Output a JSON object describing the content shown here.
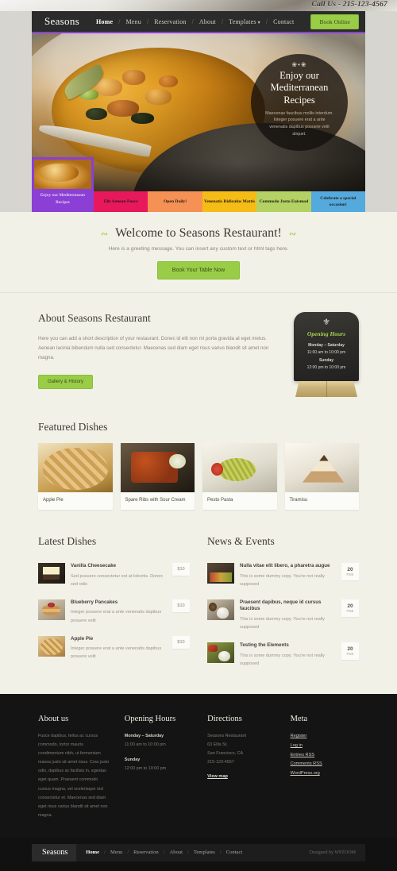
{
  "topbar": {
    "phone": "Call Us - 215-123-4567"
  },
  "header": {
    "logo": "Seasons",
    "nav": [
      {
        "label": "Home",
        "active": true
      },
      {
        "label": "Menu",
        "active": false
      },
      {
        "label": "Reservation",
        "active": false
      },
      {
        "label": "About",
        "active": false
      },
      {
        "label": "Templates",
        "active": false,
        "caret": "▾"
      },
      {
        "label": "Contact",
        "active": false
      }
    ],
    "book_online": "Book Online"
  },
  "hero": {
    "badge": {
      "ornament": "❀•❀",
      "title": "Enjoy our Mediterranean Recipes",
      "text": "Maecenas faucibus mollis interdum. Integer posuere erat a ante venenatis dapibus posuere velit aliquet."
    },
    "thumbs": [
      {
        "caption": "Enjoy our Mediterranean Recipes",
        "color": "#8b3fd4",
        "active": true
      },
      {
        "caption": "Elit Aenean Fusce",
        "color": "#e8185c",
        "active": false
      },
      {
        "caption": "Open Daily!",
        "color": "#f59154",
        "active": false
      },
      {
        "caption": "Venenatis Ridiculus Mattis",
        "color": "#f5bc17",
        "active": false
      },
      {
        "caption": "Commodo Justo Euismod",
        "color": "#b4d163",
        "active": false
      },
      {
        "caption": "Celebrate a special occasion!",
        "color": "#55aadd",
        "active": false
      }
    ]
  },
  "welcome": {
    "heading": "Welcome to Seasons Restaurant!",
    "subtext": "Here is a greeting message. You can insert any custom text or html tags here.",
    "cta": "Book Your Table Now"
  },
  "about": {
    "heading": "About Seasons Restaurant",
    "body": "Here you can add a short description of your restaurant. Donec id elit non mi porta gravida at eget metus. Aenean lacinia bibendum nulla sed consectetur. Maecenas sed diam eget risus varius blandit sit amet non magna.",
    "cta": "Gallery & History",
    "sign": {
      "fleur": "⚜",
      "title": "Opening Hours",
      "days1": "Monday – Saturday",
      "hours1": "11:00 am to 10:00 pm",
      "days2": "Sunday",
      "hours2": "12:00 pm to 10:00 pm"
    }
  },
  "featured": {
    "heading": "Featured Dishes",
    "items": [
      {
        "caption": "Apple Pie",
        "img": "img-pie"
      },
      {
        "caption": "Spare Ribs with Sour Cream",
        "img": "img-ribs"
      },
      {
        "caption": "Pesto Pasta",
        "img": "img-pesto"
      },
      {
        "caption": "Tiramisu",
        "img": "img-tira"
      }
    ]
  },
  "latest_dishes": {
    "heading": "Latest Dishes",
    "items": [
      {
        "title": "Vanilla Cheesecake",
        "desc": "Sed posuere consectetur est at lobortis. Donec sed odio",
        "price": "$10",
        "img": "t-cheese"
      },
      {
        "title": "Blueberry Pancakes",
        "desc": "Integer posuere erat a ante venenatis dapibus posuere velit",
        "price": "$10",
        "img": "t-pancake"
      },
      {
        "title": "Apple Pie",
        "desc": "Integer posuere erat a ante venenatis dapibus posuere velit",
        "price": "$10",
        "img": "t-applepie"
      }
    ]
  },
  "news_events": {
    "heading": "News & Events",
    "items": [
      {
        "title": "Nulla vitae elit libero, a pharetra augue",
        "desc": "This is some dummy copy. You're not really supposed",
        "day": "20",
        "month": "FEB",
        "img": "t-chef"
      },
      {
        "title": "Praesent dapibus, neque id cursus faucibus",
        "desc": "This is some dummy copy. You're not really supposed",
        "day": "20",
        "month": "FEB",
        "img": "t-bowls"
      },
      {
        "title": "Testing the Elements",
        "desc": "This is some dummy copy. You're not really supposed",
        "day": "20",
        "month": "FEB",
        "img": "t-veg"
      }
    ]
  },
  "footer": {
    "about": {
      "heading": "About us",
      "body": "Fusce dapibus, tellus ac cursus commodo, tortor mauris condimentum nibh, ut fermentum massa justo sit amet risus. Cras justo odio, dapibus ac facilisis in, egestas eget quam. Praesent commodo cursus magna, vel scelerisque nisl consectetur et. Maecenas sed diam eget risus varius blandit sit amet non magna."
    },
    "hours": {
      "heading": "Opening Hours",
      "days1": "Monday – Saturday",
      "hours1": "11:00 am to 10:00 pm",
      "days2": "Sunday",
      "hours2": "12:00 pm to 10:00 pm"
    },
    "directions": {
      "heading": "Directions",
      "line1": "Seasons Restaurant",
      "line2": "63 Ellis St,",
      "line3": "San Francisco, CA",
      "line4": "215-123-4567",
      "map_link": "View map"
    },
    "meta": {
      "heading": "Meta",
      "links": [
        "Register",
        "Log in",
        "Entries RSS",
        "Comments RSS",
        "WordPress.org"
      ]
    }
  },
  "bottombar": {
    "logo": "Seasons",
    "nav": [
      {
        "label": "Home",
        "active": true
      },
      {
        "label": "Menu",
        "active": false
      },
      {
        "label": "Reservation",
        "active": false
      },
      {
        "label": "About",
        "active": false
      },
      {
        "label": "Templates",
        "active": false
      },
      {
        "label": "Contact",
        "active": false
      }
    ],
    "credit": "Designed by WPZOOM"
  }
}
